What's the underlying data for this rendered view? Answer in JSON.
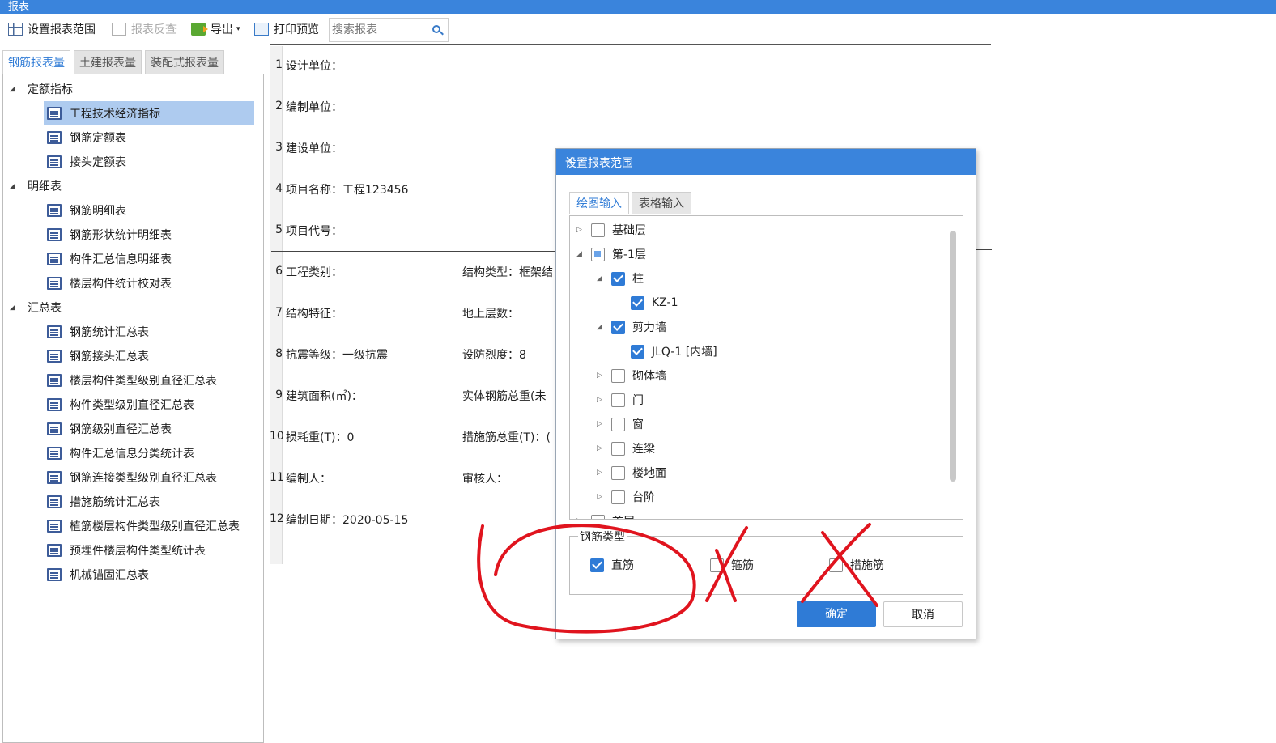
{
  "window": {
    "title": "报表"
  },
  "toolbar": {
    "set_range": "设置报表范围",
    "reverse_check": "报表反查",
    "export": "导出",
    "print_preview": "打印预览",
    "search_placeholder": "搜索报表"
  },
  "left": {
    "tabs": [
      "钢筋报表量",
      "土建报表量",
      "装配式报表量"
    ],
    "groups": [
      {
        "label": "定额指标",
        "items": [
          "工程技术经济指标",
          "钢筋定额表",
          "接头定额表"
        ]
      },
      {
        "label": "明细表",
        "items": [
          "钢筋明细表",
          "钢筋形状统计明细表",
          "构件汇总信息明细表",
          "楼层构件统计校对表"
        ]
      },
      {
        "label": "汇总表",
        "items": [
          "钢筋统计汇总表",
          "钢筋接头汇总表",
          "楼层构件类型级别直径汇总表",
          "构件类型级别直径汇总表",
          "钢筋级别直径汇总表",
          "构件汇总信息分类统计表",
          "钢筋连接类型级别直径汇总表",
          "措施筋统计汇总表",
          "植筋楼层构件类型级别直径汇总表",
          "预埋件楼层构件类型统计表",
          "机械锚固汇总表"
        ]
      }
    ],
    "selected": "工程技术经济指标"
  },
  "report": {
    "lines": [
      {
        "n": "1",
        "a": "设计单位：",
        "b": ""
      },
      {
        "n": "2",
        "a": "编制单位：",
        "b": ""
      },
      {
        "n": "3",
        "a": "建设单位：",
        "b": ""
      },
      {
        "n": "4",
        "a": "项目名称：工程123456",
        "b": ""
      },
      {
        "n": "5",
        "a": "项目代号：",
        "b": ""
      },
      {
        "n": "6",
        "a": "工程类别：",
        "b": "结构类型：框架结"
      },
      {
        "n": "7",
        "a": "结构特征：",
        "b": "地上层数："
      },
      {
        "n": "8",
        "a": "抗震等级：一级抗震",
        "b": "设防烈度：8"
      },
      {
        "n": "9",
        "a": "建筑面积(㎡)：",
        "b": "实体钢筋总重(未"
      },
      {
        "n": "10",
        "a": "损耗重(T)：0",
        "b": "措施筋总重(T)：("
      },
      {
        "n": "11",
        "a": "编制人：",
        "b": "审核人："
      },
      {
        "n": "12",
        "a": "编制日期：2020-05-15",
        "b": ""
      }
    ]
  },
  "dialog": {
    "title": "设置报表范围",
    "tabs": [
      "绘图输入",
      "表格输入"
    ],
    "tree": [
      {
        "label": "基础层",
        "state": "unchecked",
        "expander": "right",
        "level": 0
      },
      {
        "label": "第-1层",
        "state": "partial",
        "expander": "down",
        "level": 0
      },
      {
        "label": "柱",
        "state": "checked",
        "expander": "down",
        "level": 1
      },
      {
        "label": "KZ-1",
        "state": "checked",
        "expander": "",
        "level": 2
      },
      {
        "label": "剪力墙",
        "state": "checked",
        "expander": "down",
        "level": 1
      },
      {
        "label": "JLQ-1 [内墙]",
        "state": "checked",
        "expander": "",
        "level": 2
      },
      {
        "label": "砌体墙",
        "state": "unchecked",
        "expander": "right",
        "level": 1
      },
      {
        "label": "门",
        "state": "unchecked",
        "expander": "right",
        "level": 1
      },
      {
        "label": "窗",
        "state": "unchecked",
        "expander": "right",
        "level": 1
      },
      {
        "label": "连梁",
        "state": "unchecked",
        "expander": "right",
        "level": 1
      },
      {
        "label": "楼地面",
        "state": "unchecked",
        "expander": "right",
        "level": 1
      },
      {
        "label": "台阶",
        "state": "unchecked",
        "expander": "right",
        "level": 1
      },
      {
        "label": "首层",
        "state": "unchecked",
        "expander": "right",
        "level": 0
      }
    ],
    "rebar_type_label": "钢筋类型",
    "rebar_types": [
      {
        "label": "直筋",
        "checked": true
      },
      {
        "label": "箍筋",
        "checked": false
      },
      {
        "label": "措施筋",
        "checked": false
      }
    ],
    "ok": "确定",
    "cancel": "取消"
  },
  "colors": {
    "accent": "#3a84dc",
    "annotation": "#e0141e",
    "selected_row": "#aecbef"
  }
}
